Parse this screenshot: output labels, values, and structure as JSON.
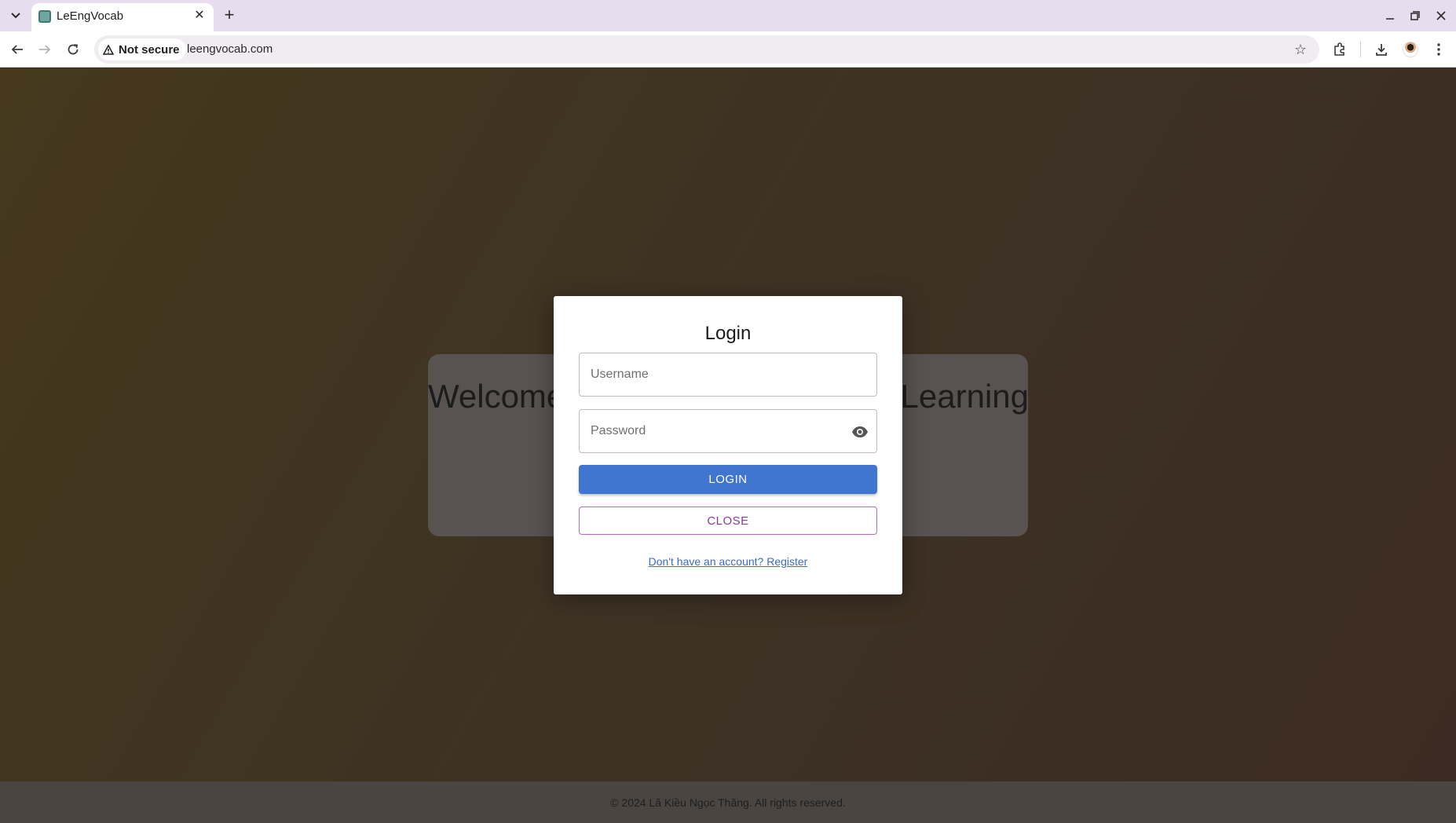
{
  "browser": {
    "tab_title": "LeEngVocab",
    "security_label": "Not secure",
    "url": "leengvocab.com"
  },
  "page": {
    "welcome_text": "Welcome to English Vocabulary Learning",
    "footer_text": "© 2024 Lã Kiều Ngọc Thăng. All rights reserved."
  },
  "login_modal": {
    "title": "Login",
    "username_placeholder": "Username",
    "password_placeholder": "Password",
    "login_button": "LOGIN",
    "close_button": "CLOSE",
    "register_link": "Don't have an account? Register"
  },
  "colors": {
    "primary": "#4176d0",
    "secondary": "#8a3a99",
    "link": "#3b6bc6"
  }
}
